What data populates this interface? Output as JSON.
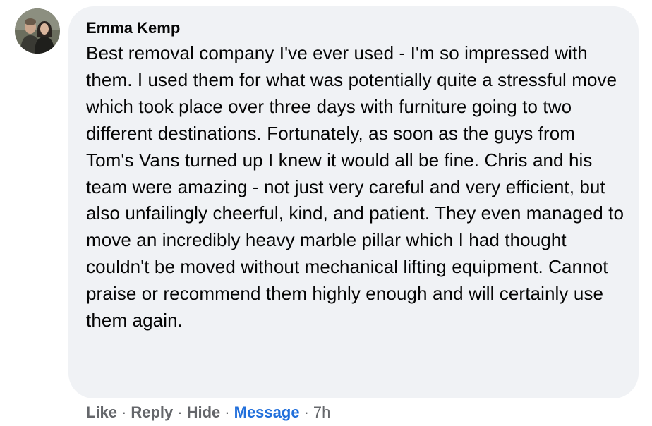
{
  "comment": {
    "author": "Emma Kemp",
    "text": "Best removal company I've ever used - I'm so impressed with them. I used them for what was potentially quite a stressful move which took place over three days with furniture going to two different destinations. Fortunately, as soon as the guys from Tom's Vans turned up I knew it would all be fine. Chris and his team were amazing - not just very careful and very efficient, but also unfailingly cheerful, kind, and patient. They even managed to move an incredibly heavy marble pillar which I had thought couldn't be moved without mechanical lifting equipment. Cannot praise or recommend them highly enough and will certainly use them again.",
    "avatar_icon": "profile-photo"
  },
  "actions": {
    "like": "Like",
    "reply": "Reply",
    "hide": "Hide",
    "message": "Message",
    "separator": "·",
    "time": "7h"
  },
  "colors": {
    "bubble": "#f0f2f5",
    "text": "#050505",
    "secondary": "#65676b",
    "link": "#216fdb"
  }
}
